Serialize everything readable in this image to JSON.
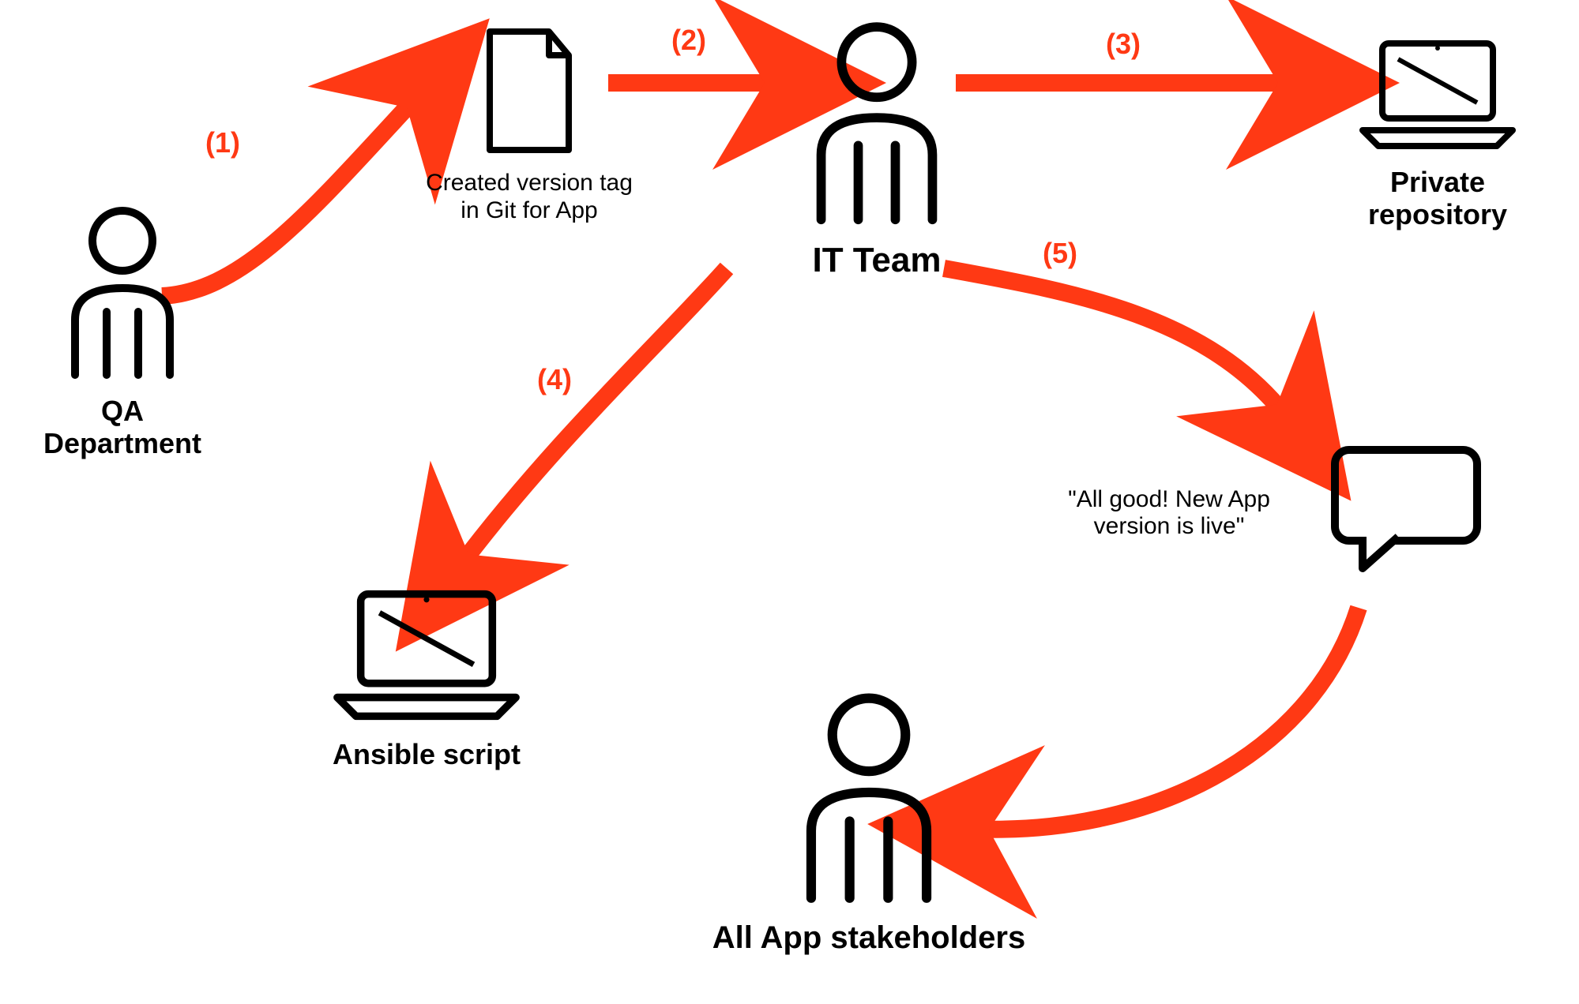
{
  "nodes": {
    "qa": {
      "label": "QA Department"
    },
    "doc": {
      "label": "Created version tag\nin Git for App"
    },
    "itteam": {
      "label": "IT Team"
    },
    "repo": {
      "label": "Private\nrepository"
    },
    "ansible": {
      "label": "Ansible script"
    },
    "message": {
      "label": "\"All good! New App\nversion is live\""
    },
    "stakeholders": {
      "label": "All App stakeholders"
    }
  },
  "steps": {
    "s1": "(1)",
    "s2": "(2)",
    "s3": "(3)",
    "s4": "(4)",
    "s5": "(5)"
  },
  "colors": {
    "arrow": "#ff3914",
    "stroke": "#000000"
  }
}
